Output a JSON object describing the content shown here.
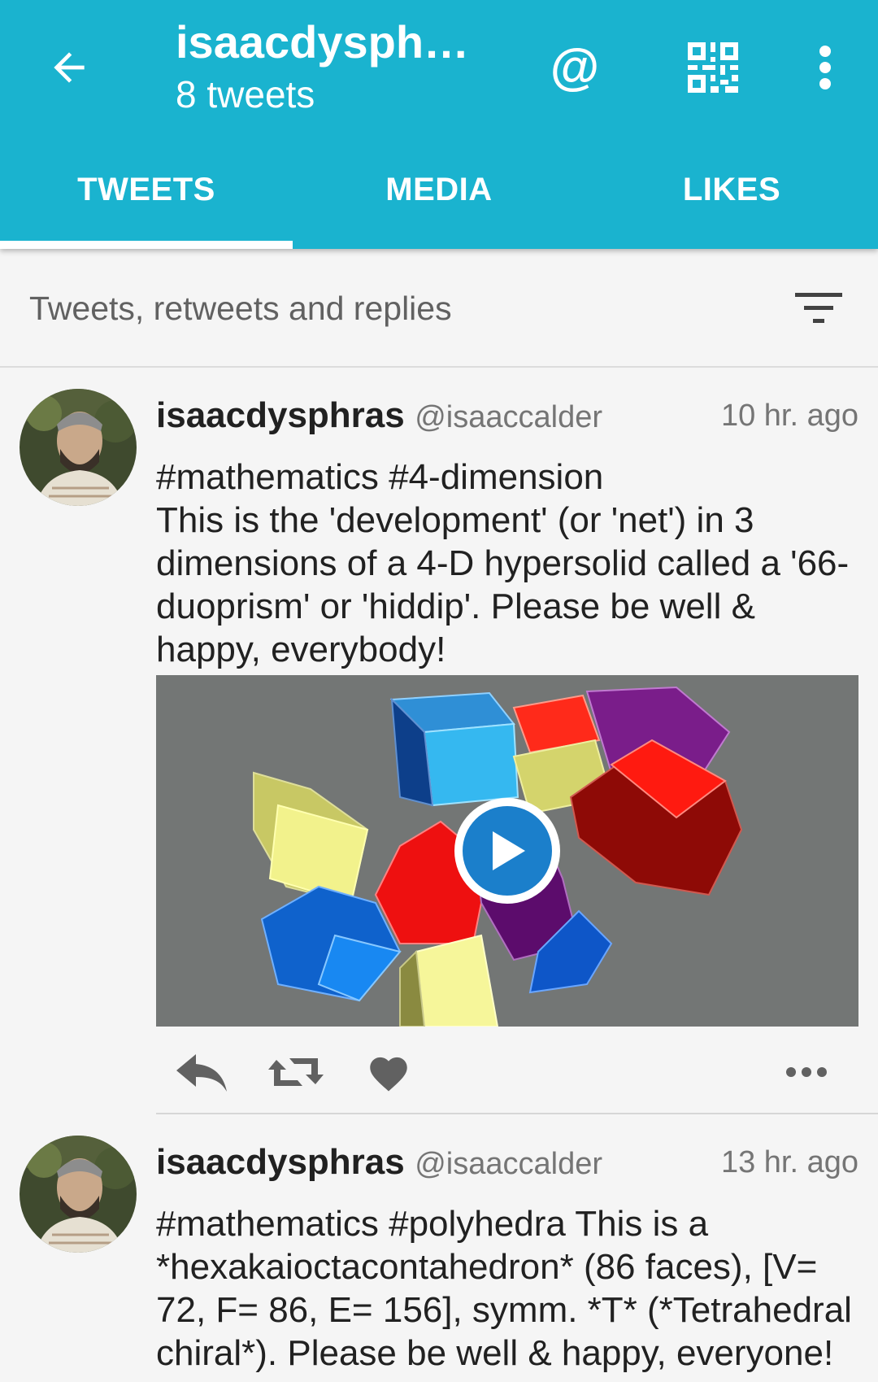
{
  "appbar": {
    "title": "isaacdysphr…",
    "subtitle": "8 tweets",
    "mention_icon": "@",
    "icons": [
      "back-arrow-icon",
      "at-sign-icon",
      "qr-code-icon",
      "more-vert-icon"
    ]
  },
  "tabs": [
    {
      "label": "TWEETS",
      "active": true
    },
    {
      "label": "MEDIA",
      "active": false
    },
    {
      "label": "LIKES",
      "active": false
    }
  ],
  "filter": {
    "label": "Tweets, retweets and replies",
    "icon": "filter-list-icon"
  },
  "tweets": [
    {
      "name": "isaacdysphras",
      "handle": "@isaaccalder",
      "time": "10 hr. ago",
      "text": "#mathematics #4-dimension\nThis is the 'development' (or 'net') in 3 dimensions of a 4-D hypersolid called a '66-duoprism' or 'hiddip'. Please be well & happy, everybody!",
      "media": {
        "type": "video",
        "icon": "play-icon"
      },
      "actions": [
        "reply-icon",
        "retweet-icon",
        "like-heart-icon",
        "more-horiz-icon"
      ]
    },
    {
      "name": "isaacdysphras",
      "handle": "@isaaccalder",
      "time": "13 hr. ago",
      "text": "#mathematics #polyhedra This is a *hexakaioctacontahedron* (86 faces), [V= 72, F= 86, E= 156], symm. *T* (*Tetrahedral chiral*). Please be well & happy, everyone!"
    }
  ],
  "colors": {
    "appbar": "#1ab3cf",
    "play_button": "#1b7fcb",
    "background": "#f5f5f5"
  }
}
